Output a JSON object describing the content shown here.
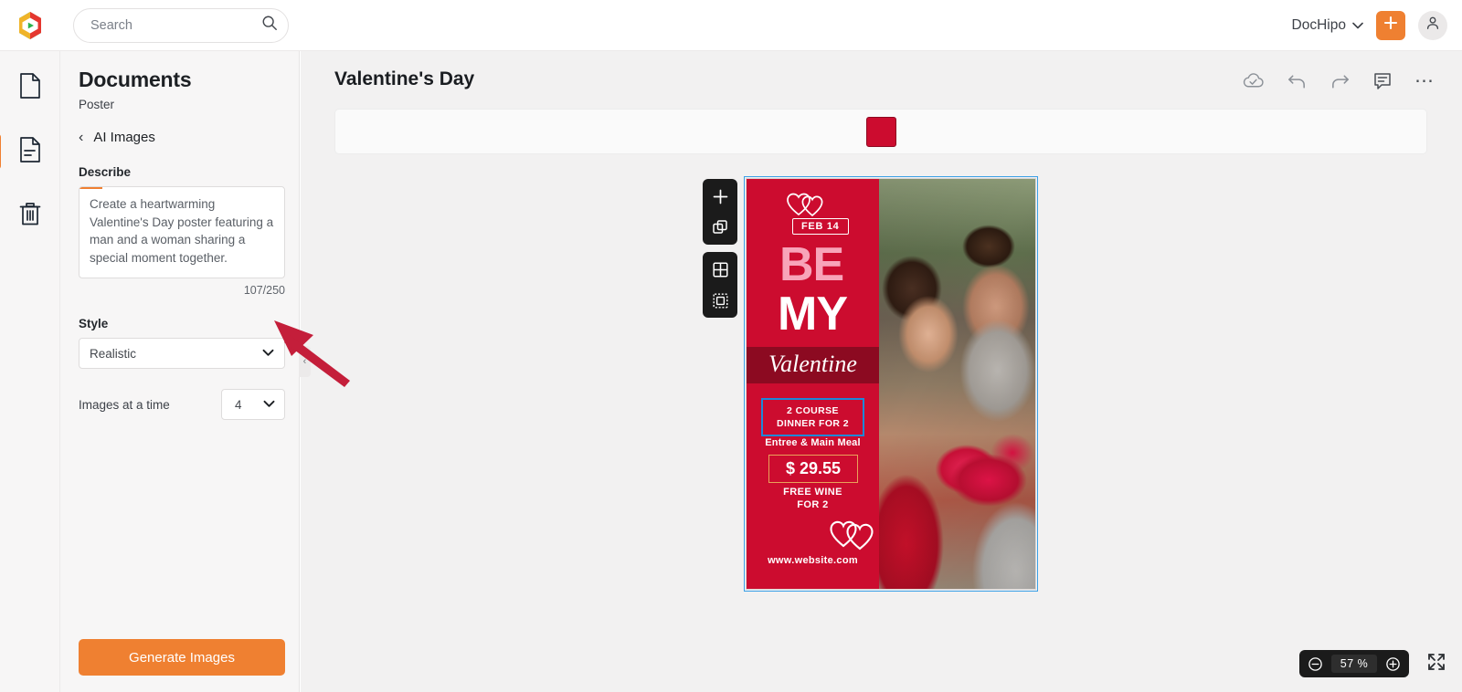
{
  "topbar": {
    "logo_icon": "dochipo-logo-icon",
    "search": {
      "placeholder": "Search",
      "value": "",
      "icon": "search-icon"
    },
    "brand": "DocHipo",
    "brand_chevron": "chevron-down-icon",
    "add_icon": "plus-icon",
    "account_icon": "user-avatar-icon"
  },
  "rail": {
    "items": [
      {
        "name": "blank-page",
        "icon": "page-icon"
      },
      {
        "name": "document",
        "icon": "document-lines-icon",
        "active": true
      },
      {
        "name": "trash",
        "icon": "trash-icon"
      }
    ]
  },
  "panel": {
    "title": "Documents",
    "subtitle": "Poster",
    "back_chevron": "‹",
    "back_label": "AI Images",
    "describe_label": "Describe",
    "describe_value": "Create a heartwarming Valentine's Day poster featuring a man and a woman sharing a special moment together.",
    "char_count": "107/250",
    "style_label": "Style",
    "style_value": "Realistic",
    "style_chevron": "⌄",
    "images_label": "Images at a time",
    "images_value": "4",
    "images_chevron": "⌄",
    "generate_label": "Generate Images",
    "collapse_chevron": "‹"
  },
  "main": {
    "doc_title": "Valentine's Day",
    "tools": [
      {
        "name": "cloud-saved-icon"
      },
      {
        "name": "undo-icon"
      },
      {
        "name": "redo-icon"
      },
      {
        "name": "comment-icon"
      },
      {
        "name": "more-options-icon",
        "glyph": "⋯"
      }
    ],
    "context_toolbar": {
      "color_swatch": "#cc0c2f"
    },
    "float_tools": [
      {
        "name": "add-element-icon"
      },
      {
        "name": "duplicate-icon"
      },
      {
        "name": "grid-layout-icon"
      },
      {
        "name": "crop-selection-icon"
      }
    ],
    "zoom": {
      "minus_icon": "zoom-out-icon",
      "value": "57 %",
      "plus_icon": "zoom-in-icon",
      "fullscreen_icon": "fullscreen-icon"
    }
  },
  "poster": {
    "hearts_top_icon": "double-heart-icon",
    "date_badge": "FEB 14",
    "headline_1": "BE",
    "headline_2": "MY",
    "script_word": "Valentine",
    "offer_line_1": "2 COURSE",
    "offer_line_2": "DINNER FOR 2",
    "offer_sub": "Entree & Main Meal",
    "price": "$ 29.55",
    "bonus_line_1": "FREE WINE",
    "bonus_line_2": "FOR 2",
    "hearts_bottom_icon": "double-heart-icon",
    "website": "www.website.com",
    "colors": {
      "bg_red": "#cc0c2f",
      "band_red": "#8c0a21",
      "pink": "#f8a4b9",
      "selection_blue": "#1e88d8",
      "price_border": "#eaa15a"
    }
  },
  "annotation": {
    "arrow_color": "#c41e3a",
    "name": "pointer-arrow"
  }
}
